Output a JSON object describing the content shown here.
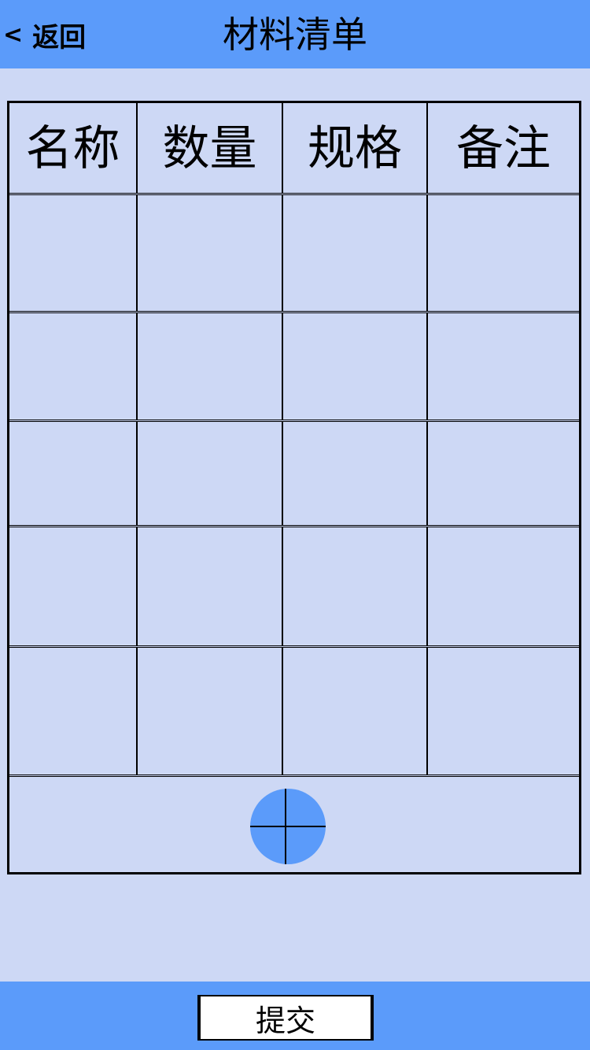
{
  "header": {
    "back_chevron": "<",
    "back_label": "返回",
    "title": "材料清单"
  },
  "table": {
    "columns": [
      "名称",
      "数量",
      "规格",
      "备注"
    ],
    "rows": [
      [
        "",
        "",
        "",
        ""
      ],
      [
        "",
        "",
        "",
        ""
      ],
      [
        "",
        "",
        "",
        ""
      ],
      [
        "",
        "",
        "",
        ""
      ],
      [
        "",
        "",
        "",
        ""
      ]
    ],
    "add_row_icon": "plus-circle-icon"
  },
  "footer": {
    "submit_label": "提交"
  },
  "colors": {
    "bar": "#5b9bfa",
    "background": "#cdd8f5",
    "submit_bg": "#ffffff"
  }
}
